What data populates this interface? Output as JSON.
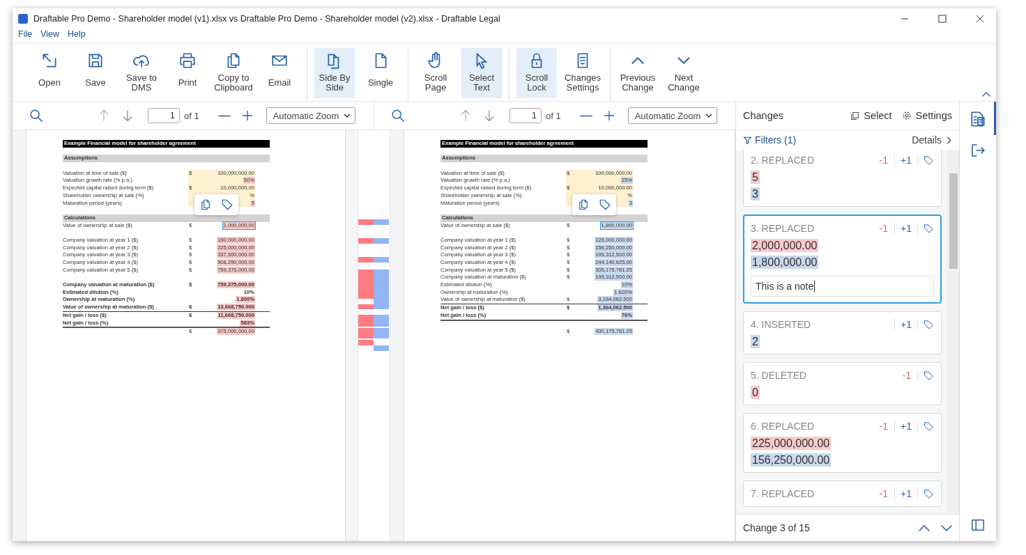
{
  "window": {
    "title": "Draftable Pro Demo - Shareholder model (v1).xlsx vs Draftable Pro Demo - Shareholder model (v2).xlsx - Draftable Legal"
  },
  "menu": [
    "File",
    "View",
    "Help"
  ],
  "ribbon": [
    [
      {
        "label": "Open",
        "selected": false
      },
      {
        "label": "Save",
        "selected": false
      },
      {
        "label": "Save to DMS",
        "selected": false
      },
      {
        "label": "Print",
        "selected": false
      },
      {
        "label": "Copy to Clipboard",
        "selected": false
      },
      {
        "label": "Email",
        "selected": false
      }
    ],
    [
      {
        "label": "Side By Side",
        "selected": true
      },
      {
        "label": "Single",
        "selected": false
      }
    ],
    [
      {
        "label": "Scroll Page",
        "selected": false
      },
      {
        "label": "Select Text",
        "selected": true
      }
    ],
    [
      {
        "label": "Scroll Lock",
        "selected": true
      },
      {
        "label": "Changes Settings",
        "selected": false
      }
    ],
    [
      {
        "label": "Previous Change",
        "selected": false
      },
      {
        "label": "Next Change",
        "selected": false
      }
    ]
  ],
  "viewers": [
    {
      "page": "1",
      "of": "of 1",
      "zoom": "Automatic Zoom",
      "rows": [
        {
          "kind": "title",
          "label": "Example Financial model for shareholder agreement"
        },
        {
          "kind": "blank"
        },
        {
          "kind": "section",
          "label": "Assumptions"
        },
        {
          "kind": "blank"
        },
        {
          "kind": "row",
          "label": "Valuation at time of sale ($)",
          "currency": "$",
          "value": "100,000,000.00",
          "input": true,
          "changed": false
        },
        {
          "kind": "row",
          "label": "Valuation growth rate (% p.a.)",
          "value": "50%",
          "input": true,
          "changed": true
        },
        {
          "kind": "row",
          "label": "Expected capital raised during term ($)",
          "currency": "$",
          "value": "10,000,000.00",
          "input": true,
          "changed": false
        },
        {
          "kind": "row",
          "label": "Shareholder ownership at sale (%)",
          "value": "%",
          "input": true,
          "changed": false
        },
        {
          "kind": "row",
          "label": "Maturation period (years)",
          "value": "5",
          "input": true,
          "changed": true
        },
        {
          "kind": "blank"
        },
        {
          "kind": "section",
          "label": "Calculations"
        },
        {
          "kind": "row",
          "label": "Value of ownership at sale ($)",
          "currency": "$",
          "value": "2,000,000.00",
          "changed": true,
          "focused": true
        },
        {
          "kind": "blank"
        },
        {
          "kind": "row",
          "label": "Company valuation at year 1 ($)",
          "currency": "$",
          "value": "150,000,000.00",
          "changed": true
        },
        {
          "kind": "row",
          "label": "Company valuation at year 2 ($)",
          "currency": "$",
          "value": "225,000,000.00",
          "changed": true
        },
        {
          "kind": "row",
          "label": "Company valuation at year 3 ($)",
          "currency": "$",
          "value": "337,500,000.00",
          "changed": true
        },
        {
          "kind": "row",
          "label": "Company valuation at year 4 ($)",
          "currency": "$",
          "value": "506,250,000.00",
          "changed": true
        },
        {
          "kind": "row",
          "label": "Company valuation at year 5 ($)",
          "currency": "$",
          "value": "759,375,000.00",
          "changed": true
        },
        {
          "kind": "blank"
        },
        {
          "kind": "row",
          "label": "Company valuation at maturation ($)",
          "currency": "$",
          "value": "759,375,000.00",
          "changed": true,
          "bold": true
        },
        {
          "kind": "row",
          "label": "Estimated dilution (%)",
          "value": "10%",
          "changed": false,
          "bold": true
        },
        {
          "kind": "row",
          "label": "Ownership at maturation (%)",
          "value": "1.800%",
          "changed": true,
          "bold": true
        },
        {
          "kind": "row",
          "label": "Value of ownership at maturation ($)",
          "currency": "$",
          "value": "13,668,750.000",
          "changed": true,
          "bold": true
        },
        {
          "kind": "row",
          "label": "Net gain / loss ($)",
          "currency": "$",
          "value": "11,668,750.000",
          "changed": true,
          "bold": true,
          "rule_above": true
        },
        {
          "kind": "row",
          "label": "Net gain / loss (%)",
          "value": "583%",
          "changed": true,
          "bold": true,
          "rule_below": true
        },
        {
          "kind": "row",
          "currency": "$",
          "value": "375,000,000.00",
          "changed": true
        }
      ]
    },
    {
      "page": "1",
      "of": "of 1",
      "zoom": "Automatic Zoom",
      "rows": [
        {
          "kind": "title",
          "label": "Example Financial model for shareholder agreement"
        },
        {
          "kind": "blank"
        },
        {
          "kind": "section",
          "label": "Assumptions"
        },
        {
          "kind": "blank"
        },
        {
          "kind": "row",
          "label": "Valuation at time of sale ($)",
          "currency": "$",
          "value": "100,000,000.00",
          "input": true,
          "changed": false
        },
        {
          "kind": "row",
          "label": "Valuation growth rate (% p.a.)",
          "value": "25%",
          "input": true,
          "changed": true
        },
        {
          "kind": "row",
          "label": "Expected capital raised during term ($)",
          "currency": "$",
          "value": "10,000,000.00",
          "input": true,
          "changed": false
        },
        {
          "kind": "row",
          "label": "Shareholder ownership at sale (%)",
          "value": "%",
          "input": true,
          "changed": false
        },
        {
          "kind": "row",
          "label": "Maturation period (years)",
          "value": "3",
          "input": true,
          "changed": true
        },
        {
          "kind": "blank"
        },
        {
          "kind": "section",
          "label": "Calculations"
        },
        {
          "kind": "row",
          "label": "Value of ownership at sale ($)",
          "currency": "$",
          "value": "1,800,000.00",
          "changed": true,
          "focused": true
        },
        {
          "kind": "blank"
        },
        {
          "kind": "row",
          "label": "Company valuation at year 1 ($)",
          "currency": "$",
          "value": "125,000,000.00",
          "changed": true
        },
        {
          "kind": "row",
          "label": "Company valuation at year 2 ($)",
          "currency": "$",
          "value": "156,250,000.00",
          "changed": true
        },
        {
          "kind": "row",
          "label": "Company valuation at year 3 ($)",
          "currency": "$",
          "value": "195,312,500.00",
          "changed": true
        },
        {
          "kind": "row",
          "label": "Company valuation at year 4 ($)",
          "currency": "$",
          "value": "244,140,625.00",
          "changed": true
        },
        {
          "kind": "row",
          "label": "Company valuation at year 5 ($)",
          "currency": "$",
          "value": "305,175,781.25",
          "changed": true
        },
        {
          "kind": "row",
          "label": "Company valuation at maturation ($)",
          "currency": "$",
          "value": "195,312,500.00",
          "changed": true
        },
        {
          "kind": "row",
          "label": "Estimated dilution (%)",
          "value": "10%",
          "changed": true
        },
        {
          "kind": "row",
          "label": "Ownership at maturation (%)",
          "value": "1.620%",
          "changed": true
        },
        {
          "kind": "row",
          "label": "Value of ownership at maturation ($)",
          "currency": "$",
          "value": "3,164,062.500",
          "changed": true
        },
        {
          "kind": "row",
          "label": "Net gain / loss ($)",
          "currency": "$",
          "value": "1,364,062.500",
          "changed": true,
          "bold": true,
          "rule_above": true
        },
        {
          "kind": "row",
          "label": "Net gain / loss (%)",
          "value": "76%",
          "changed": true,
          "bold": true,
          "rule_below": true
        },
        {
          "kind": "blank"
        },
        {
          "kind": "row",
          "currency": "$",
          "value": "430,175,781.25",
          "changed": true
        }
      ]
    }
  ],
  "changes": {
    "title": "Changes",
    "select": "Select",
    "settings": "Settings",
    "filters": "Filters (1)",
    "details": "Details",
    "cards": [
      {
        "title": "2. REPLACED",
        "minus": "-1",
        "plus": "+1",
        "selected": false,
        "values": [
          {
            "text": "5",
            "kind": "deleted"
          },
          {
            "text": "3",
            "kind": "inserted"
          }
        ]
      },
      {
        "title": "3. REPLACED",
        "minus": "-1",
        "plus": "+1",
        "selected": true,
        "values": [
          {
            "text": "2,000,000.00",
            "kind": "deleted"
          },
          {
            "text": "1,800,000.00",
            "kind": "inserted"
          }
        ],
        "note": "This is a note"
      },
      {
        "title": "4. INSERTED",
        "plus": "+1",
        "selected": false,
        "values": [
          {
            "text": "2",
            "kind": "inserted"
          }
        ]
      },
      {
        "title": "5. DELETED",
        "minus": "-1",
        "selected": false,
        "values": [
          {
            "text": "0",
            "kind": "deleted"
          }
        ]
      },
      {
        "title": "6. REPLACED",
        "minus": "-1",
        "plus": "+1",
        "selected": false,
        "values": [
          {
            "text": "225,000,000.00",
            "kind": "deleted"
          },
          {
            "text": "156,250,000.00",
            "kind": "inserted"
          }
        ]
      },
      {
        "title": "7. REPLACED",
        "minus": "-1",
        "plus": "+1",
        "selected": false
      }
    ],
    "footer": "Change 3 of 15"
  }
}
